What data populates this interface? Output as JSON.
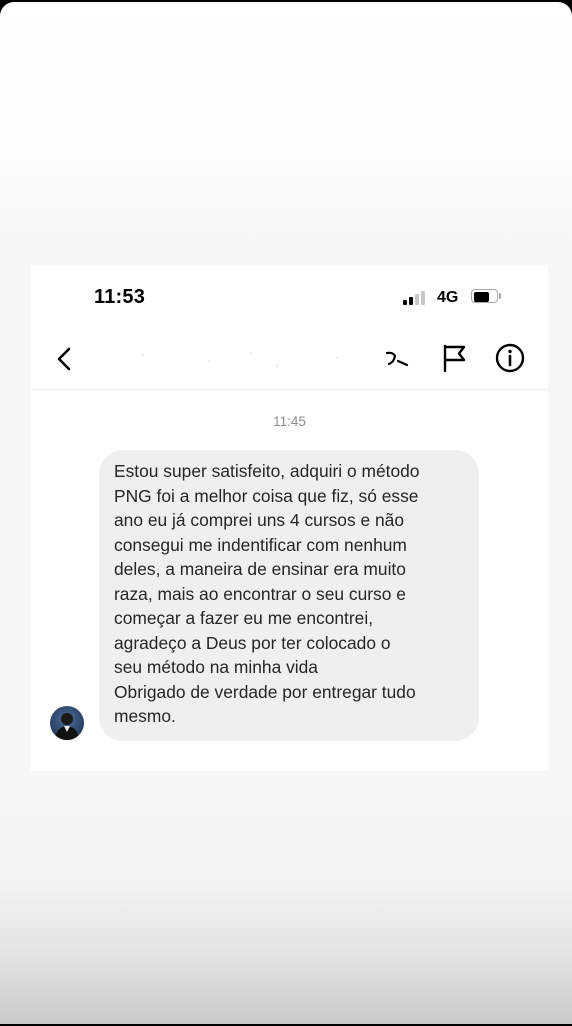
{
  "status_bar": {
    "time": "11:53",
    "network": "4G",
    "signal_bars_active": 2,
    "signal_bars_total": 4,
    "battery_level": 0.75
  },
  "nav": {
    "back_icon": "chevron-left-icon",
    "contact_name_redacted": true,
    "actions": [
      {
        "icon": "video-camera-icon"
      },
      {
        "icon": "flag-icon"
      },
      {
        "icon": "info-icon"
      }
    ]
  },
  "conversation": {
    "timestamp": "11:45",
    "message": {
      "lines": [
        "Estou super satisfeito, adquiri o método",
        "PNG foi a melhor coisa que fiz, só esse",
        "ano eu já comprei uns 4 cursos e não",
        "consegui me indentificar com nenhum",
        "deles, a maneira de ensinar era muito",
        "raza, mais ao encontrar o seu curso e",
        "começar a fazer eu me encontrei,",
        "agradeço a Deus por ter colocado o",
        "seu método na minha vida",
        "Obrigado de verdade por entregar tudo",
        "mesmo."
      ]
    },
    "sender_avatar_icon": "user-avatar-icon"
  },
  "colors": {
    "bubble_background": "#efefef",
    "text_primary": "#262626",
    "timestamp": "#8e8e8e",
    "battery_outline": "#a8a8a8",
    "signal_inactive": "#c7c7c7"
  }
}
